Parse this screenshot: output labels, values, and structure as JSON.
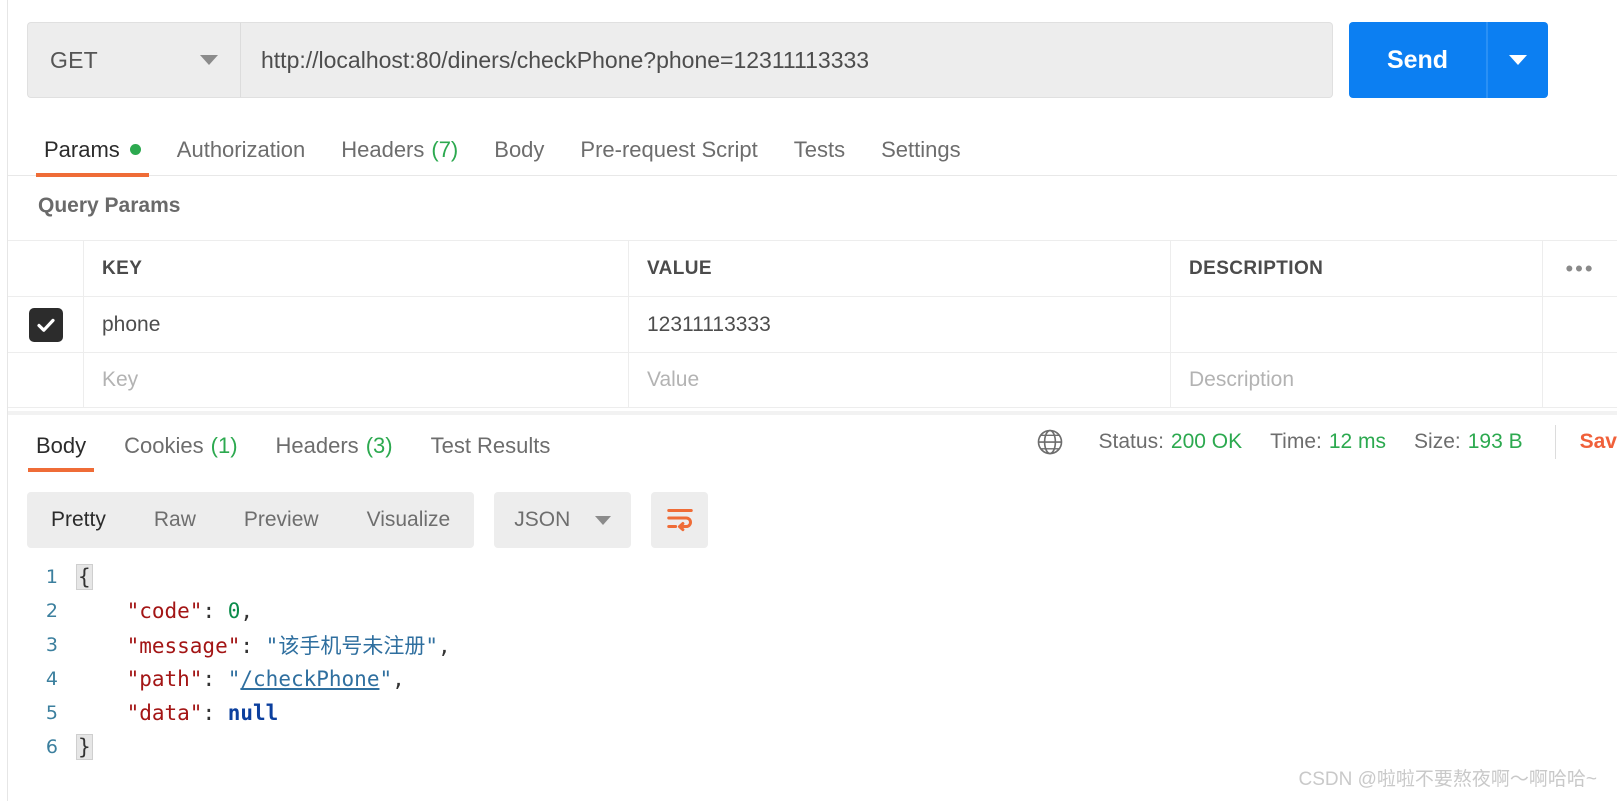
{
  "request": {
    "method": "GET",
    "url": "http://localhost:80/diners/checkPhone?phone=12311113333",
    "send_label": "Send",
    "method_caret": "chevron-down-icon",
    "tabs": [
      {
        "label": "Params",
        "badge_dot": true,
        "active": true
      },
      {
        "label": "Authorization",
        "active": false
      },
      {
        "label": "Headers",
        "count": "(7)",
        "active": false
      },
      {
        "label": "Body",
        "active": false
      },
      {
        "label": "Pre-request Script",
        "active": false
      },
      {
        "label": "Tests",
        "active": false
      },
      {
        "label": "Settings",
        "active": false
      }
    ]
  },
  "query_params": {
    "section_title": "Query Params",
    "columns": [
      "KEY",
      "VALUE",
      "DESCRIPTION"
    ],
    "bulk_edit_icon": "•••",
    "rows": [
      {
        "checked": true,
        "key": "phone",
        "value": "12311113333",
        "description": ""
      }
    ],
    "placeholder_row": {
      "key": "Key",
      "value": "Value",
      "description": "Description"
    }
  },
  "response": {
    "tabs": [
      {
        "label": "Body",
        "active": true
      },
      {
        "label": "Cookies",
        "count": "(1)",
        "active": false
      },
      {
        "label": "Headers",
        "count": "(3)",
        "active": false
      },
      {
        "label": "Test Results",
        "active": false
      }
    ],
    "status": {
      "label": "Status:",
      "value": "200 OK"
    },
    "time": {
      "label": "Time:",
      "value": "12 ms"
    },
    "size": {
      "label": "Size:",
      "value": "193 B"
    },
    "save_response_label": "Sav",
    "globe_icon": "globe-icon",
    "view_modes": [
      {
        "label": "Pretty",
        "active": true
      },
      {
        "label": "Raw",
        "active": false
      },
      {
        "label": "Preview",
        "active": false
      },
      {
        "label": "Visualize",
        "active": false
      }
    ],
    "format_selected": "JSON",
    "wrap_icon": "wrap-text-icon"
  },
  "code": {
    "lines": [
      {
        "no": "1",
        "indent": "",
        "tokens": [
          {
            "t": "{",
            "c": "brace"
          }
        ]
      },
      {
        "no": "2",
        "indent": "    ",
        "tokens": [
          {
            "t": "\"code\"",
            "c": "k-str"
          },
          {
            "t": ": ",
            "c": "punct"
          },
          {
            "t": "0",
            "c": "v-num"
          },
          {
            "t": ",",
            "c": "punct"
          }
        ]
      },
      {
        "no": "3",
        "indent": "    ",
        "tokens": [
          {
            "t": "\"message\"",
            "c": "k-str"
          },
          {
            "t": ": ",
            "c": "punct"
          },
          {
            "t": "\"该手机号未注册\"",
            "c": "v-str"
          },
          {
            "t": ",",
            "c": "punct"
          }
        ]
      },
      {
        "no": "4",
        "indent": "    ",
        "tokens": [
          {
            "t": "\"path\"",
            "c": "k-str"
          },
          {
            "t": ": ",
            "c": "punct"
          },
          {
            "t": "\"",
            "c": "v-str"
          },
          {
            "t": "/checkPhone",
            "c": "lnk"
          },
          {
            "t": "\"",
            "c": "v-str"
          },
          {
            "t": ",",
            "c": "punct"
          }
        ]
      },
      {
        "no": "5",
        "indent": "    ",
        "tokens": [
          {
            "t": "\"data\"",
            "c": "k-str"
          },
          {
            "t": ": ",
            "c": "punct"
          },
          {
            "t": "null",
            "c": "v-null"
          }
        ]
      },
      {
        "no": "6",
        "indent": "",
        "tokens": [
          {
            "t": "}",
            "c": "brace"
          }
        ]
      }
    ]
  },
  "watermark": "CSDN @啦啦不要熬夜啊～啊哈哈~",
  "colors": {
    "accent_orange": "#ef6c37",
    "send_blue": "#0c7ff2",
    "success_green": "#2ca94f",
    "save_orange": "#f0603a"
  }
}
